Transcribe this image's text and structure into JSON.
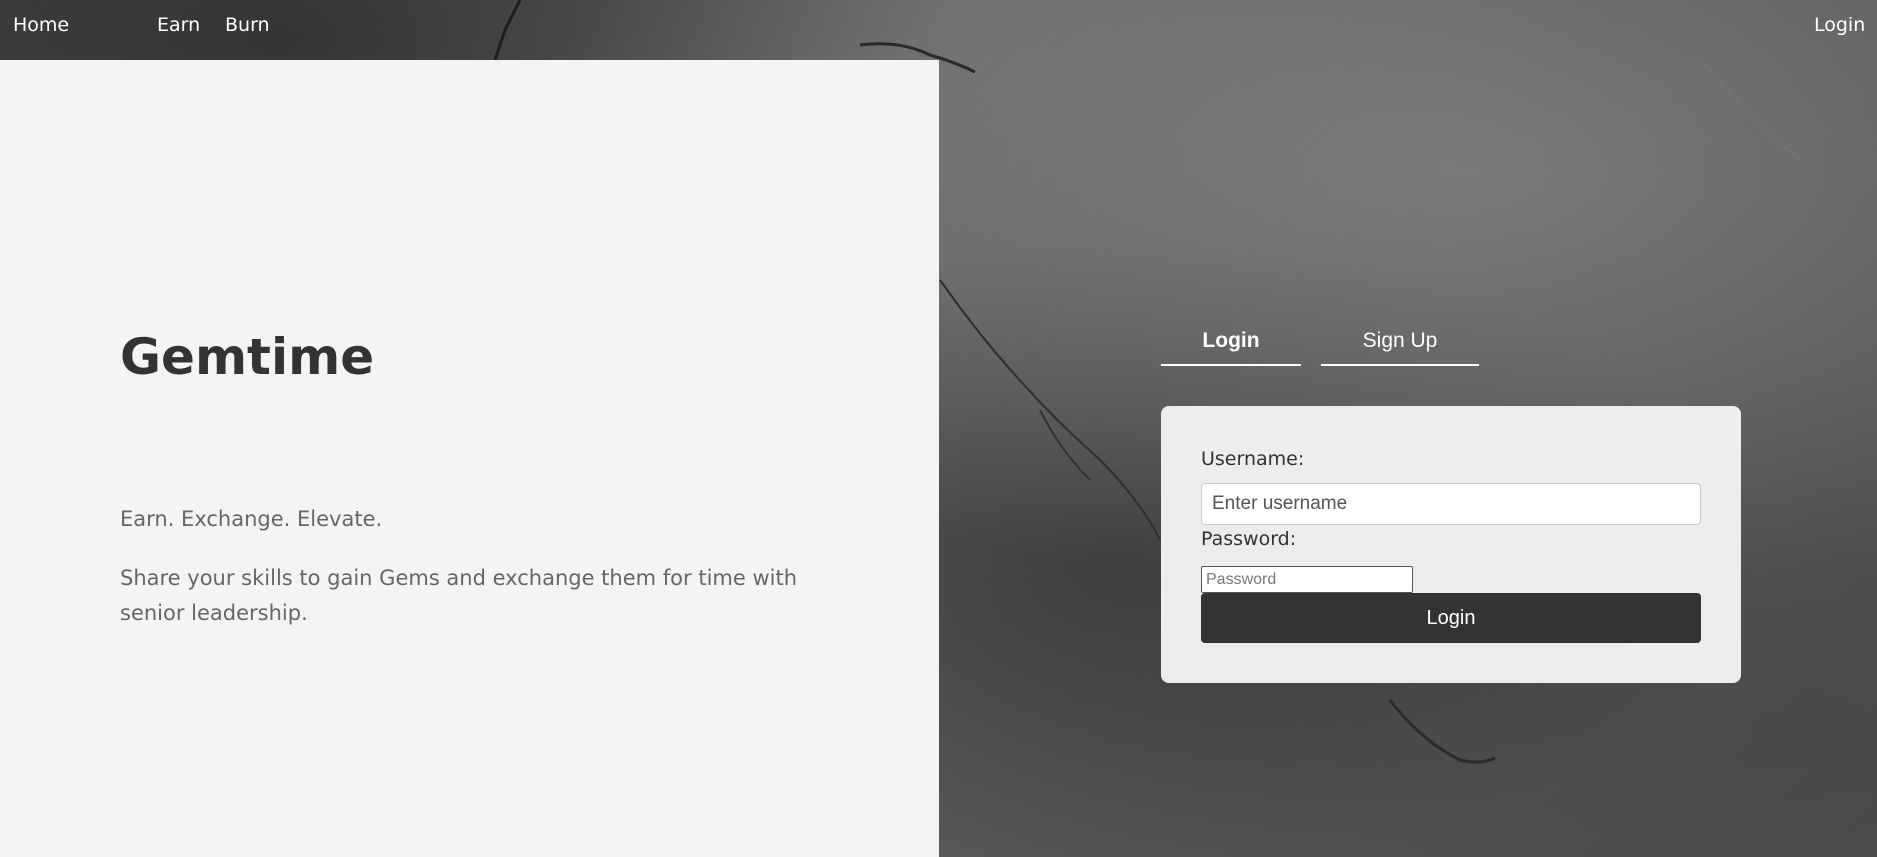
{
  "nav": {
    "home": "Home",
    "earn": "Earn",
    "burn": "Burn",
    "login": "Login"
  },
  "hero": {
    "title": "Gemtime",
    "tagline": "Earn. Exchange. Elevate.",
    "description": "Share your skills to gain Gems and exchange them for time with senior leadership."
  },
  "auth": {
    "tabs": [
      {
        "label": "Login",
        "active": true
      },
      {
        "label": "Sign Up",
        "active": false
      }
    ],
    "username_label": "Username:",
    "username_placeholder": "Enter username",
    "password_label": "Password:",
    "password_placeholder": "Password",
    "submit_label": "Login"
  },
  "colors": {
    "panel_bg": "#f4f4f4",
    "title_text": "#333333",
    "body_text": "#666666",
    "button_bg": "#333333",
    "button_text": "#ffffff"
  }
}
